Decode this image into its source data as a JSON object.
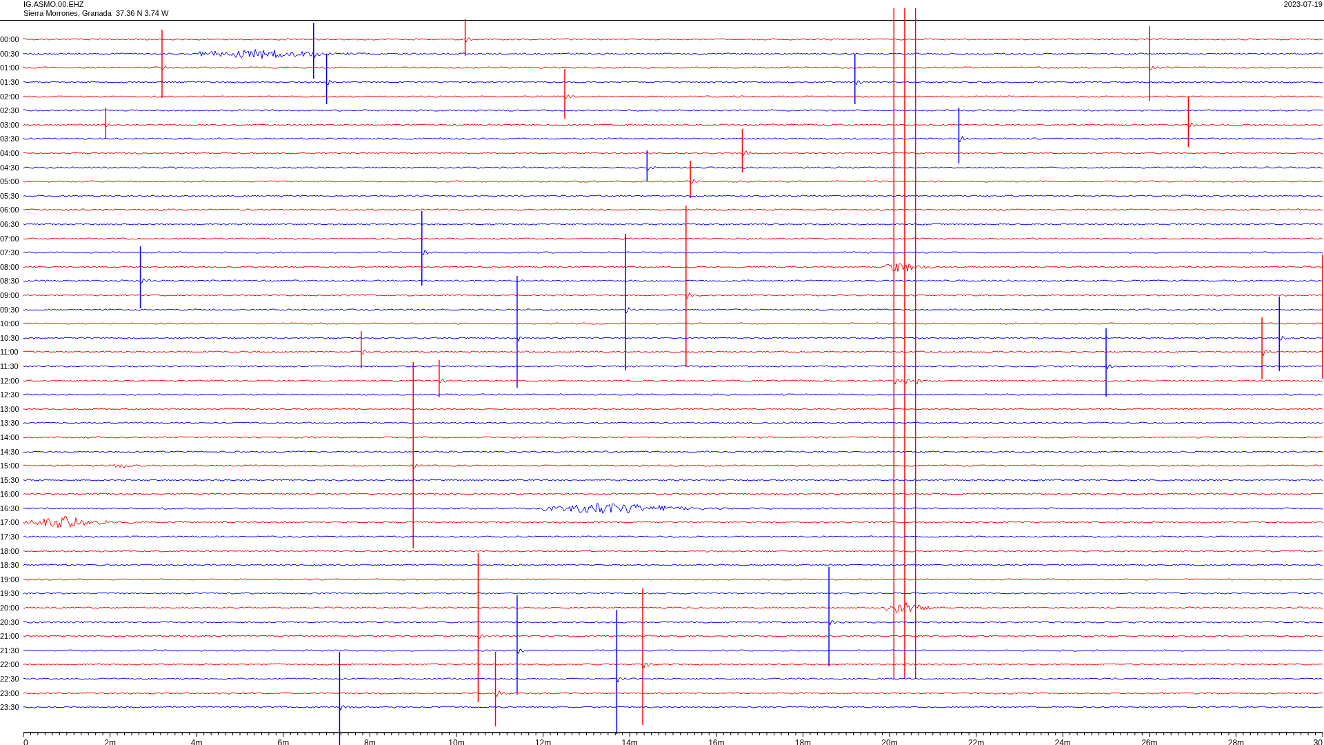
{
  "header": {
    "station": "IG.ASMO.00.EHZ",
    "location": "Sierra Morrones, Granada  37.36 N 3.74 W",
    "date": "2023-07-19"
  },
  "traces": [
    {
      "label": "00:00",
      "color": "#ff0000"
    },
    {
      "label": "00:30",
      "color": "#0000ff"
    },
    {
      "label": "01:00",
      "color": "#ff0000"
    },
    {
      "label": "01:30",
      "color": "#0000ff"
    },
    {
      "label": "02:00",
      "color": "#ff0000"
    },
    {
      "label": "02:30",
      "color": "#0000ff"
    },
    {
      "label": "03:00",
      "color": "#ff0000"
    },
    {
      "label": "03:30",
      "color": "#0000ff"
    },
    {
      "label": "04:00",
      "color": "#ff0000"
    },
    {
      "label": "04:30",
      "color": "#0000ff"
    },
    {
      "label": "05:00",
      "color": "#ff0000"
    },
    {
      "label": "05:30",
      "color": "#0000ff"
    },
    {
      "label": "06:00",
      "color": "#ff0000"
    },
    {
      "label": "06:30",
      "color": "#0000ff"
    },
    {
      "label": "07:00",
      "color": "#ff0000"
    },
    {
      "label": "07:30",
      "color": "#0000ff"
    },
    {
      "label": "08:00",
      "color": "#ff0000"
    },
    {
      "label": "08:30",
      "color": "#0000ff"
    },
    {
      "label": "09:00",
      "color": "#ff0000"
    },
    {
      "label": "09:30",
      "color": "#0000ff"
    },
    {
      "label": "10:00",
      "color": "#ff0000"
    },
    {
      "label": "10:30",
      "color": "#0000ff"
    },
    {
      "label": "11:00",
      "color": "#ff0000"
    },
    {
      "label": "11:30",
      "color": "#0000ff"
    },
    {
      "label": "12:00",
      "color": "#ff0000"
    },
    {
      "label": "12:30",
      "color": "#0000ff"
    },
    {
      "label": "13:00",
      "color": "#ff0000"
    },
    {
      "label": "13:30",
      "color": "#0000ff"
    },
    {
      "label": "14:00",
      "color": "#ff0000"
    },
    {
      "label": "14:30",
      "color": "#0000ff"
    },
    {
      "label": "15:00",
      "color": "#ff0000"
    },
    {
      "label": "15:30",
      "color": "#0000ff"
    },
    {
      "label": "16:00",
      "color": "#ff0000"
    },
    {
      "label": "16:30",
      "color": "#0000ff"
    },
    {
      "label": "17:00",
      "color": "#ff0000"
    },
    {
      "label": "17:30",
      "color": "#0000ff"
    },
    {
      "label": "18:00",
      "color": "#ff0000"
    },
    {
      "label": "18:30",
      "color": "#0000ff"
    },
    {
      "label": "19:00",
      "color": "#ff0000"
    },
    {
      "label": "19:30",
      "color": "#0000ff"
    },
    {
      "label": "20:00",
      "color": "#ff0000"
    },
    {
      "label": "20:30",
      "color": "#0000ff"
    },
    {
      "label": "21:00",
      "color": "#ff0000"
    },
    {
      "label": "21:30",
      "color": "#0000ff"
    },
    {
      "label": "22:00",
      "color": "#ff0000"
    },
    {
      "label": "22:30",
      "color": "#0000ff"
    },
    {
      "label": "23:00",
      "color": "#ff0000"
    },
    {
      "label": "23:30",
      "color": "#0000ff"
    }
  ],
  "axis": {
    "ticks": [
      "0",
      "2m",
      "4m",
      "6m",
      "8m",
      "10m",
      "12m",
      "14m",
      "16m",
      "18m",
      "20m",
      "22m",
      "24m",
      "26m",
      "28m",
      "30"
    ]
  }
}
